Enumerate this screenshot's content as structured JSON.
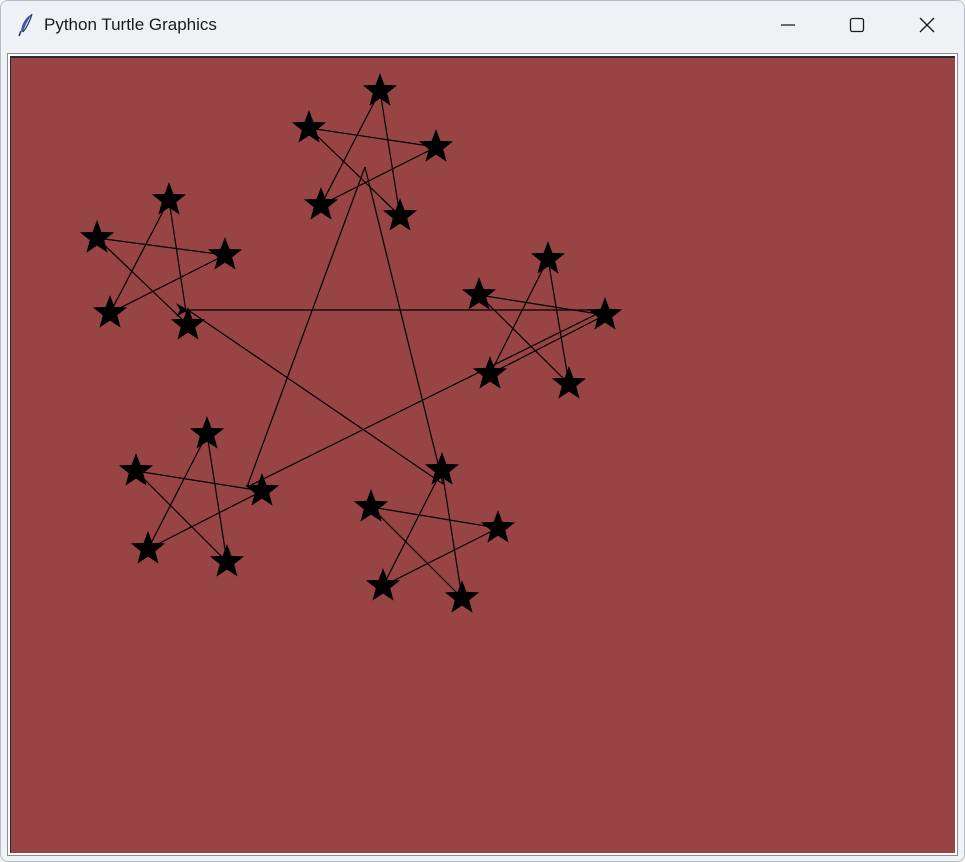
{
  "window": {
    "title": "Python Turtle Graphics",
    "app_icon": "feather-icon",
    "controls": {
      "minimize": "minimize-icon",
      "maximize": "maximize-icon",
      "close": "close-icon"
    }
  },
  "canvas": {
    "background_color": "#984444",
    "pen_color": "#000000",
    "star_fill": "#000000"
  }
}
